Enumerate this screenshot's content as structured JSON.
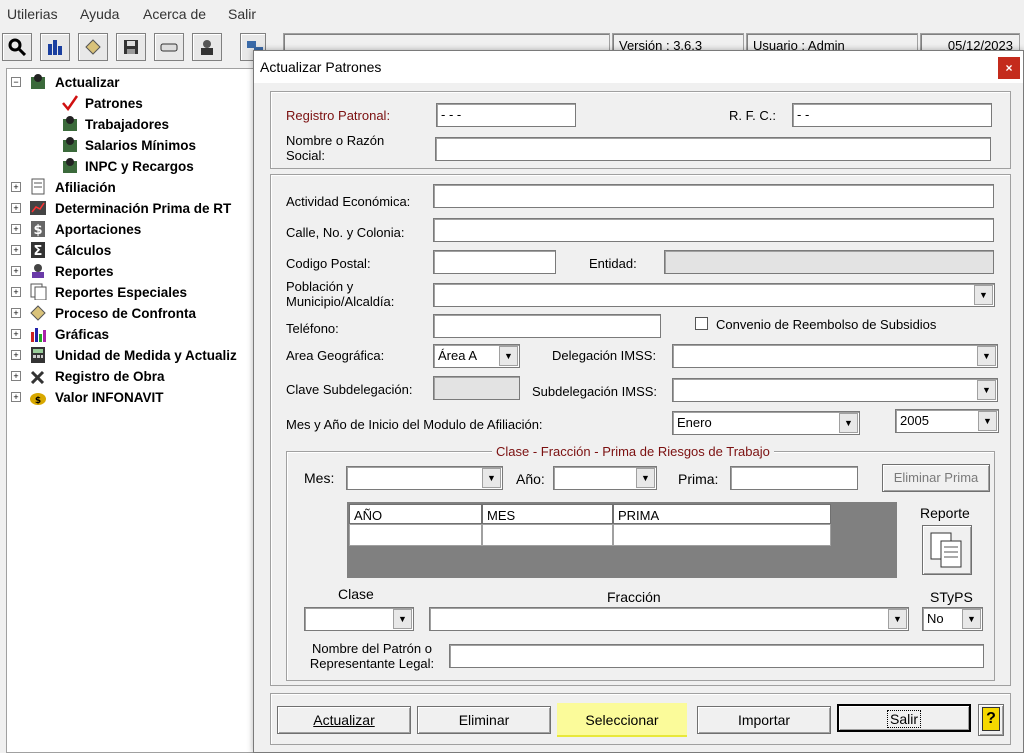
{
  "menu": [
    "Utilerias",
    "Ayuda",
    "Acerca de",
    "Salir"
  ],
  "status": {
    "version": "Versión : 3.6.3",
    "user": "Usuario : Admin",
    "date": "05/12/2023"
  },
  "tree": {
    "root": "Actualizar",
    "children": [
      "Patrones",
      "Trabajadores",
      "Salarios Mínimos",
      "INPC y Recargos"
    ],
    "items": [
      "Afiliación",
      "Determinación Prima de RT",
      "Aportaciones",
      "Cálculos",
      "Reportes",
      "Reportes Especiales",
      "Proceso de Confronta",
      "Gráficas",
      "Unidad de Medida y Actualiz",
      "Registro de Obra",
      "Valor INFONAVIT"
    ]
  },
  "dialog": {
    "title": "Actualizar Patrones",
    "close": "×",
    "labels": {
      "registro": "Registro Patronal:",
      "rfc": "R. F. C.:",
      "nombre": "Nombre o Razón Social:",
      "actividad": "Actividad Económica:",
      "calle": "Calle, No. y Colonia:",
      "cp": "Codigo Postal:",
      "entidad": "Entidad:",
      "poblacion": "Población y Municipio/Alcaldía:",
      "telefono": "Teléfono:",
      "convenio": "Convenio de Reembolso de Subsidios",
      "area": "Area Geográfica:",
      "delegacion": "Delegación IMSS:",
      "clave_sub": "Clave Subdelegación:",
      "subdelegacion": "Subdelegación IMSS:",
      "mes_anio": "Mes y Año de Inicio del Modulo de Afiliación:",
      "mes": "Mes:",
      "anio": "Año:",
      "prima": "Prima:",
      "reporte": "Reporte",
      "clase": "Clase",
      "fraccion": "Fracción",
      "styps": "STyPS",
      "representante": "Nombre del Patrón o Representante Legal:"
    },
    "values": {
      "registro": "-    -   -",
      "rfc": "-      -",
      "area": "Área A",
      "mes_inicio": "Enero",
      "anio_inicio": "2005",
      "styps": "No"
    },
    "group_title": "Clase - Fracción - Prima de Riesgos de Trabajo",
    "table_headers": [
      "AÑO",
      "MES",
      "PRIMA"
    ],
    "buttons": {
      "eliminar_prima": "Eliminar Prima",
      "actualizar": "Actualizar",
      "eliminar": "Eliminar",
      "seleccionar": "Seleccionar",
      "importar": "Importar",
      "salir": "Salir",
      "help": "?"
    }
  }
}
